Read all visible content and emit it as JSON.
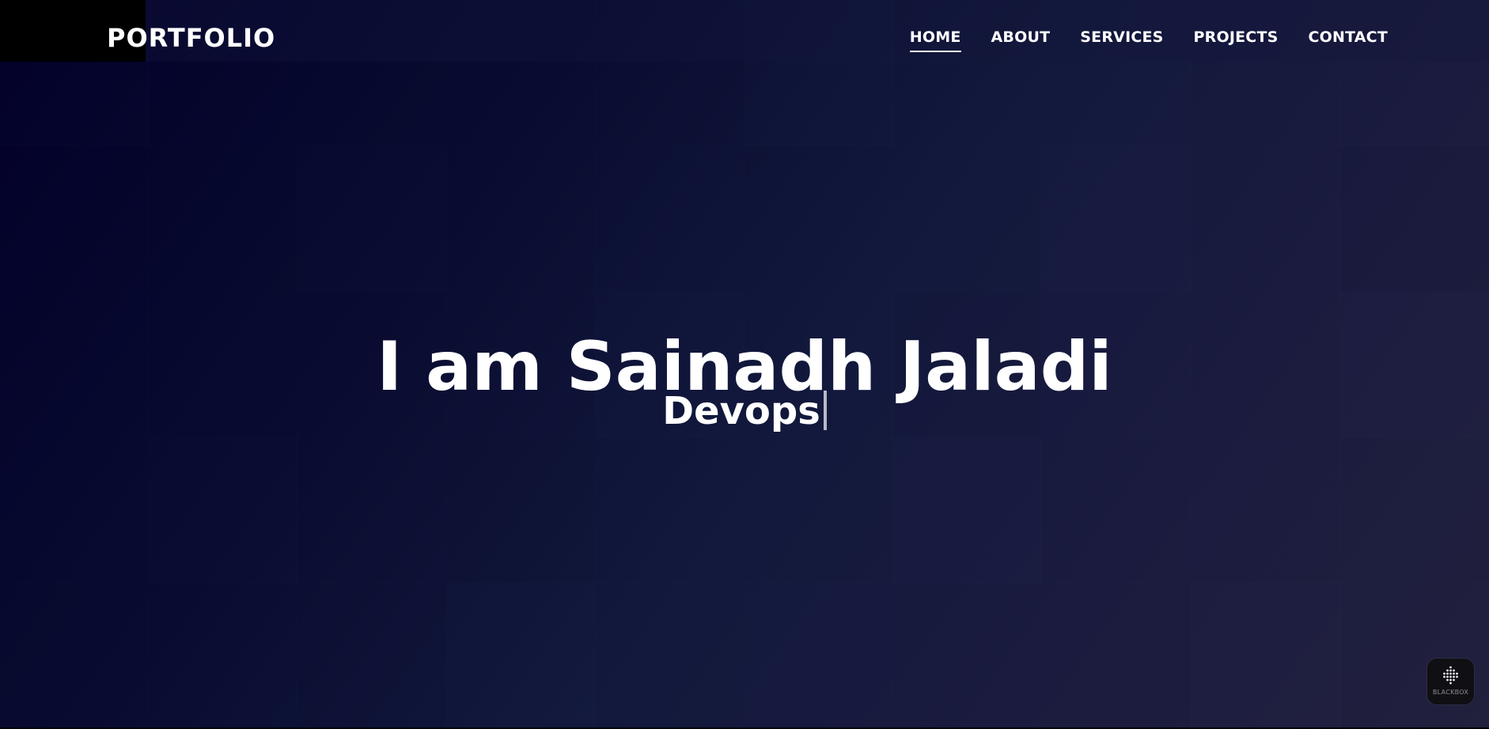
{
  "brand": {
    "logo_text": "PORTFOLIO"
  },
  "nav": {
    "items": [
      {
        "label": "HOME",
        "active": true
      },
      {
        "label": "ABOUT",
        "active": false
      },
      {
        "label": "SERVICES",
        "active": false
      },
      {
        "label": "PROJECTS",
        "active": false
      },
      {
        "label": "CONTACT",
        "active": false
      }
    ]
  },
  "hero": {
    "title": "I am Sainadh Jaladi",
    "typed_text": "Devops"
  },
  "widget": {
    "label": "BLACKBOX",
    "icon": "blackbox-icon"
  },
  "colors": {
    "background_dark": "#03012a",
    "background_light": "#22213f",
    "text": "#ffffff",
    "logo_block": "#000000"
  }
}
